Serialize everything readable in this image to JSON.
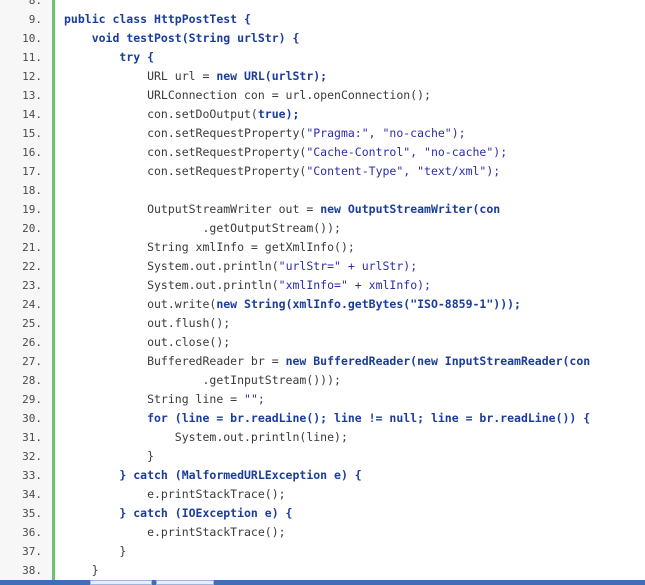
{
  "lines": [
    {
      "num": "8.",
      "tokens": []
    },
    {
      "num": "9.",
      "tokens": [
        {
          "t": "public class ",
          "c": "kw"
        },
        {
          "t": "HttpPostTest ",
          "c": "kw"
        },
        {
          "t": "{",
          "c": "kw"
        }
      ]
    },
    {
      "num": "10.",
      "tokens": [
        {
          "t": "    void ",
          "c": "kw"
        },
        {
          "t": "testPost(String urlStr) {",
          "c": "kw"
        }
      ]
    },
    {
      "num": "11.",
      "tokens": [
        {
          "t": "        try ",
          "c": "kw"
        },
        {
          "t": "{",
          "c": "kw"
        }
      ]
    },
    {
      "num": "12.",
      "tokens": [
        {
          "t": "            URL url = ",
          "c": "plain"
        },
        {
          "t": "new URL(urlStr);",
          "c": "kw"
        }
      ]
    },
    {
      "num": "13.",
      "tokens": [
        {
          "t": "            URLConnection con = url.openConnection();",
          "c": "plain"
        }
      ]
    },
    {
      "num": "14.",
      "tokens": [
        {
          "t": "            con.setDoOutput(",
          "c": "plain"
        },
        {
          "t": "true);",
          "c": "kw"
        }
      ]
    },
    {
      "num": "15.",
      "tokens": [
        {
          "t": "            con.setRequestProperty(",
          "c": "plain"
        },
        {
          "t": "\"Pragma:\", \"no-cache\");",
          "c": "str"
        }
      ]
    },
    {
      "num": "16.",
      "tokens": [
        {
          "t": "            con.setRequestProperty(",
          "c": "plain"
        },
        {
          "t": "\"Cache-Control\", \"no-cache\");",
          "c": "str"
        }
      ]
    },
    {
      "num": "17.",
      "tokens": [
        {
          "t": "            con.setRequestProperty(",
          "c": "plain"
        },
        {
          "t": "\"Content-Type\", \"text/xml\");",
          "c": "str"
        }
      ]
    },
    {
      "num": "18.",
      "tokens": []
    },
    {
      "num": "19.",
      "tokens": [
        {
          "t": "            OutputStreamWriter out = ",
          "c": "plain"
        },
        {
          "t": "new OutputStreamWriter(con",
          "c": "kw"
        }
      ]
    },
    {
      "num": "20.",
      "tokens": [
        {
          "t": "                    .getOutputStream());",
          "c": "plain"
        }
      ]
    },
    {
      "num": "21.",
      "tokens": [
        {
          "t": "            String xmlInfo = getXmlInfo();",
          "c": "plain"
        }
      ]
    },
    {
      "num": "22.",
      "tokens": [
        {
          "t": "            System.out.println(",
          "c": "plain"
        },
        {
          "t": "\"urlStr=\" + urlStr);",
          "c": "str"
        }
      ]
    },
    {
      "num": "23.",
      "tokens": [
        {
          "t": "            System.out.println(",
          "c": "plain"
        },
        {
          "t": "\"xmlInfo=\" + xmlInfo);",
          "c": "str"
        }
      ]
    },
    {
      "num": "24.",
      "tokens": [
        {
          "t": "            out.write(",
          "c": "plain"
        },
        {
          "t": "new String(xmlInfo.getBytes(\"ISO-8859-1\")));",
          "c": "kw"
        }
      ]
    },
    {
      "num": "25.",
      "tokens": [
        {
          "t": "            out.flush();",
          "c": "plain"
        }
      ]
    },
    {
      "num": "26.",
      "tokens": [
        {
          "t": "            out.close();",
          "c": "plain"
        }
      ]
    },
    {
      "num": "27.",
      "tokens": [
        {
          "t": "            BufferedReader br = ",
          "c": "plain"
        },
        {
          "t": "new BufferedReader(new InputStreamReader(con",
          "c": "kw"
        }
      ]
    },
    {
      "num": "28.",
      "tokens": [
        {
          "t": "                    .getInputStream()));",
          "c": "plain"
        }
      ]
    },
    {
      "num": "29.",
      "tokens": [
        {
          "t": "            String line = ",
          "c": "plain"
        },
        {
          "t": "\"\";",
          "c": "str"
        }
      ]
    },
    {
      "num": "30.",
      "tokens": [
        {
          "t": "            for (line = br.readLine(); line != null; line = br.readLine()) {",
          "c": "kw"
        }
      ]
    },
    {
      "num": "31.",
      "tokens": [
        {
          "t": "                System.out.println(line);",
          "c": "plain"
        }
      ]
    },
    {
      "num": "32.",
      "tokens": [
        {
          "t": "            }",
          "c": "plain"
        }
      ]
    },
    {
      "num": "33.",
      "tokens": [
        {
          "t": "        } catch (MalformedURLException e) {",
          "c": "kw"
        }
      ]
    },
    {
      "num": "34.",
      "tokens": [
        {
          "t": "            e.printStackTrace();",
          "c": "plain"
        }
      ]
    },
    {
      "num": "35.",
      "tokens": [
        {
          "t": "        } catch (IOException e) {",
          "c": "kw"
        }
      ]
    },
    {
      "num": "36.",
      "tokens": [
        {
          "t": "            e.printStackTrace();",
          "c": "plain"
        }
      ]
    },
    {
      "num": "37.",
      "tokens": [
        {
          "t": "        }",
          "c": "plain"
        }
      ]
    },
    {
      "num": "38.",
      "tokens": [
        {
          "t": "    }",
          "c": "plain"
        }
      ]
    }
  ],
  "colors": {
    "gutter_border": "#6ac36a",
    "keyword": "#1a3c9c",
    "string": "#2b2bb0",
    "bottom_bar": "#3b6fb6"
  }
}
